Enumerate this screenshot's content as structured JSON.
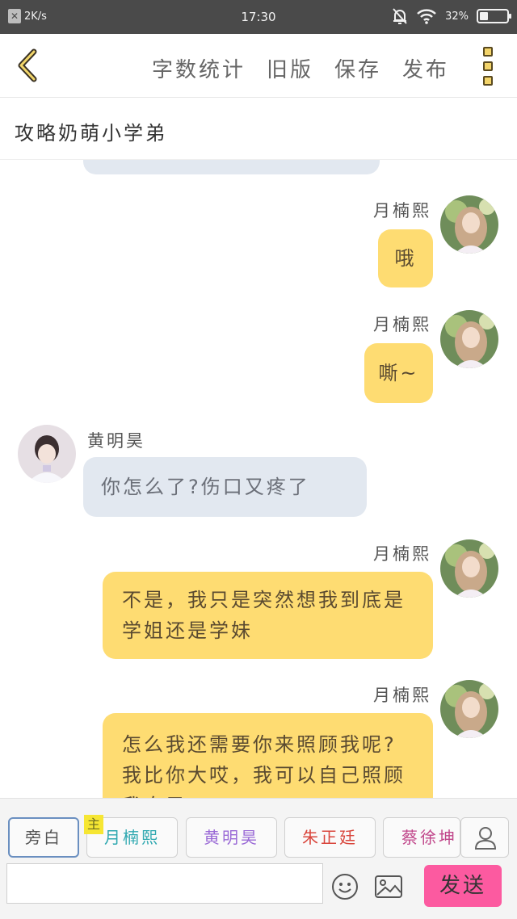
{
  "status_bar": {
    "net_speed": "2K/s",
    "time": "17:30",
    "battery": "32%",
    "battery_level": 0.32
  },
  "toolbar": {
    "word_count": "字数统计",
    "old_version": "旧版",
    "save": "保存",
    "publish": "发布"
  },
  "story": {
    "title": "攻略奶萌小学弟"
  },
  "messages": [
    {
      "speaker": "月楠熙",
      "text": "哦"
    },
    {
      "speaker": "月楠熙",
      "text": "嘶~"
    },
    {
      "speaker": "黄明昊",
      "text": "你怎么了?伤口又疼了"
    },
    {
      "speaker": "月楠熙",
      "text": "不是，我只是突然想我到底是学姐还是学妹"
    },
    {
      "speaker": "月楠熙",
      "text": "怎么我还需要你来照顾我呢?我比你大哎，我可以自己照顾我自己"
    }
  ],
  "roles": [
    {
      "label": "旁白",
      "color": "#555555"
    },
    {
      "label": "月楠熙",
      "color": "#2fa8b0"
    },
    {
      "label": "黄明昊",
      "color": "#9a6ad6"
    },
    {
      "label": "朱正廷",
      "color": "#d9463c"
    },
    {
      "label": "蔡徐坤",
      "color": "#c0468a"
    }
  ],
  "main_tag": "主",
  "send": "发送",
  "colors": {
    "my_bubble": "#fedc72",
    "other_bubble": "#e2e8f0",
    "send_button": "#fc5aa0"
  },
  "icons": {
    "back": "chevron-left-icon",
    "more": "more-vertical-icon",
    "user": "user-icon",
    "emoji": "emoji-icon",
    "image": "image-icon"
  }
}
